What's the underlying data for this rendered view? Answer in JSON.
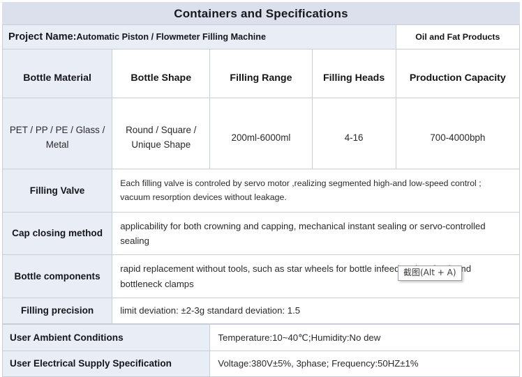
{
  "title": "Containers and Specifications",
  "project": {
    "label": "Project Name:",
    "value": "Automatic Piston / Flowmeter Filling Machine",
    "category": "Oil and Fat Products"
  },
  "spec_table": {
    "headers": [
      "Bottle Material",
      "Bottle Shape",
      "Filling Range",
      "Filling Heads",
      "Production Capacity"
    ],
    "values": [
      "PET / PP / PE / Glass / Metal",
      "Round / Square / Unique Shape",
      "200ml-6000ml",
      "4-16",
      "700-4000bph"
    ]
  },
  "detail_rows": [
    {
      "label": "Filling Valve",
      "text": "Each filling valve is controled by servo motor ,realizing segmented high-and low-speed control ; vacuum resorption devices without leakage."
    },
    {
      "label": "Cap closing method",
      "text": "applicability for both crowning and capping, mechanical instant sealing or servo-controlled sealing"
    },
    {
      "label": "Bottle components",
      "text": "rapid replacement without tools, such as star wheels for bottle infeed and outfeed, and bottleneck clamps"
    },
    {
      "label": "Filling precision",
      "text": "limit deviation: ±2-3g standard deviation: 1.5"
    }
  ],
  "user_rows": [
    {
      "label": "User Ambient Conditions",
      "text": "Temperature:10~40℃;Humidity:No dew"
    },
    {
      "label": "User Electrical Supply Specification",
      "text": "Voltage:380V±5%, 3phase; Frequency:50HZ±1%"
    }
  ],
  "overlay": {
    "snip_tooltip": "截图(Alt + A)"
  },
  "colors": {
    "title_bg": "#dbe0ec",
    "label_bg": "#e9edf5",
    "cell_border": "#c9cdd6",
    "text": "#1c1c1c"
  }
}
